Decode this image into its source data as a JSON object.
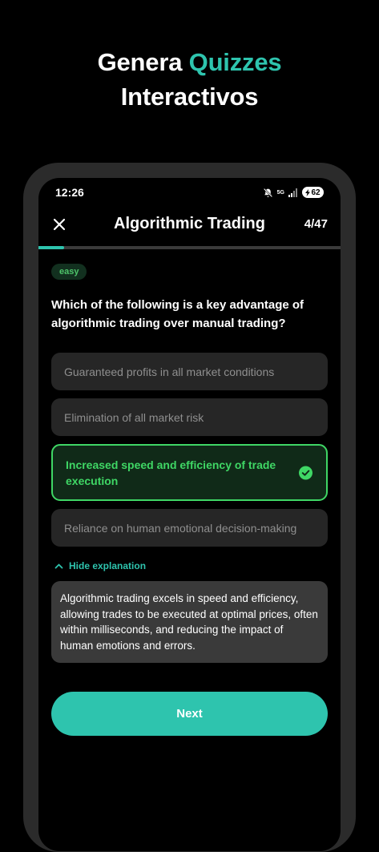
{
  "promo": {
    "headline_part1": "Genera ",
    "headline_accent": "Quizzes",
    "headline_part2": "Interactivos",
    "accent_color": "#2ec4ae"
  },
  "status_bar": {
    "time": "12:26",
    "network": "5G",
    "battery": "62",
    "icons": [
      "mute-icon",
      "network-5g-icon",
      "signal-icon",
      "battery-charging-icon"
    ]
  },
  "header": {
    "title": "Algorithmic Trading",
    "progress_label": "4/47",
    "close_icon": "close-icon"
  },
  "progress": {
    "current": 4,
    "total": 47
  },
  "question": {
    "difficulty": "easy",
    "text": "Which of the following is a key advantage of algorithmic trading over manual trading?",
    "options": [
      {
        "label": "Guaranteed profits in all market conditions",
        "state": "default"
      },
      {
        "label": "Elimination of all market risk",
        "state": "default"
      },
      {
        "label": "Increased speed and efficiency of trade execution",
        "state": "correct"
      },
      {
        "label": "Reliance on human emotional decision-making",
        "state": "default"
      }
    ]
  },
  "explanation": {
    "toggle_label": "Hide explanation",
    "text": "Algorithmic trading excels in speed and efficiency, allowing trades to be executed at optimal prices, often within milliseconds, and reducing the impact of human emotions and errors."
  },
  "actions": {
    "next_label": "Next"
  },
  "colors": {
    "accent": "#2ec4ae",
    "correct": "#3fd765",
    "option_bg": "#262626",
    "background": "#000000"
  }
}
